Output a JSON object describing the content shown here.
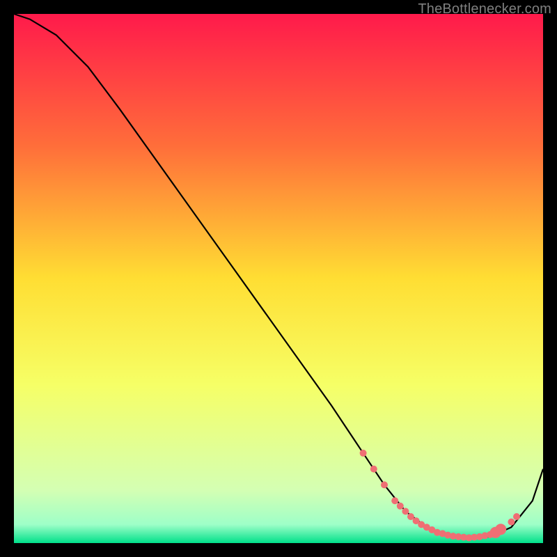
{
  "source_label": "TheBottlenecker.com",
  "chart_data": {
    "type": "line",
    "title": "",
    "xlabel": "",
    "ylabel": "",
    "xlim": [
      0,
      100
    ],
    "ylim": [
      0,
      100
    ],
    "gradient_stops": [
      {
        "offset": 0,
        "color": "#ff1a4b"
      },
      {
        "offset": 0.25,
        "color": "#ff6e3a"
      },
      {
        "offset": 0.5,
        "color": "#ffde33"
      },
      {
        "offset": 0.7,
        "color": "#f6ff66"
      },
      {
        "offset": 0.9,
        "color": "#d4ffb3"
      },
      {
        "offset": 0.965,
        "color": "#9effc8"
      },
      {
        "offset": 1.0,
        "color": "#00e08a"
      }
    ],
    "series": [
      {
        "name": "curve",
        "color": "#000000",
        "x": [
          0,
          3,
          8,
          14,
          20,
          30,
          40,
          50,
          60,
          66,
          70,
          74,
          78,
          82,
          86,
          90,
          94,
          98,
          100
        ],
        "y": [
          100,
          99,
          96,
          90,
          82,
          68,
          54,
          40,
          26,
          17,
          11,
          6,
          3,
          1.5,
          1,
          1.2,
          3,
          8,
          14
        ]
      }
    ],
    "markers": {
      "name": "sweet-spot",
      "color": "#ef6f74",
      "radius_base": 5,
      "points_x": [
        66,
        68,
        70,
        72,
        73,
        74,
        75,
        76,
        77,
        78,
        79,
        80,
        81,
        82,
        83,
        84,
        85,
        86,
        87,
        88,
        89,
        90,
        91,
        92,
        94,
        95
      ],
      "points_y": [
        17,
        14,
        11,
        8,
        7,
        6,
        5,
        4.2,
        3.5,
        3,
        2.5,
        2,
        1.8,
        1.5,
        1.3,
        1.2,
        1.1,
        1,
        1.1,
        1.2,
        1.4,
        1.6,
        2.0,
        2.6,
        4.0,
        5.0
      ],
      "big_idx": [
        22,
        23
      ]
    }
  }
}
